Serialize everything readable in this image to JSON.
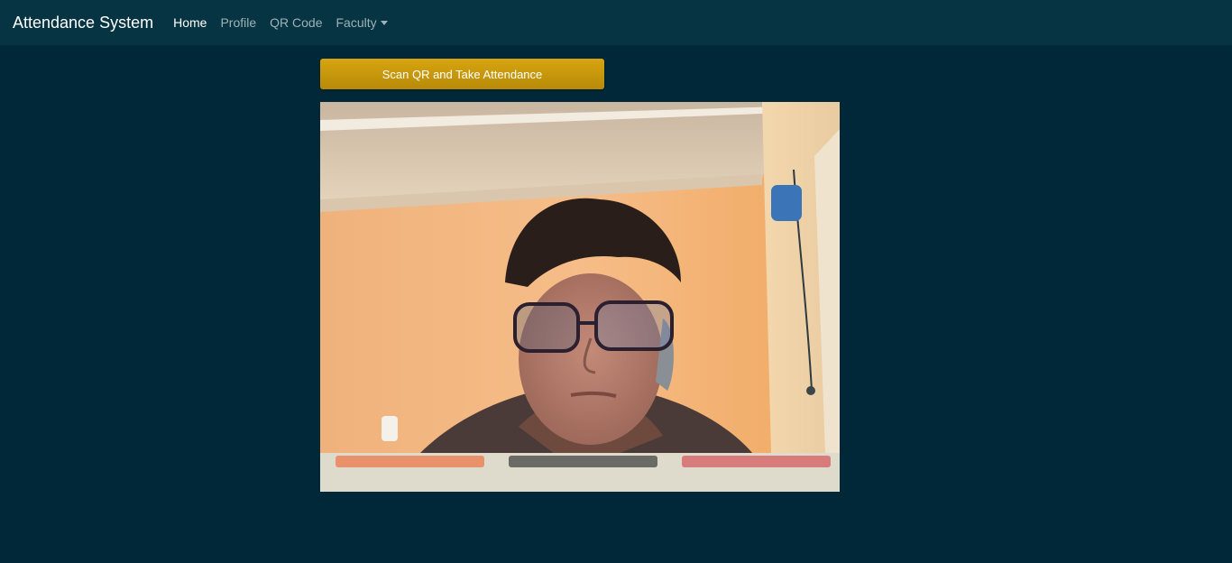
{
  "navbar": {
    "brand": "Attendance System",
    "links": [
      {
        "label": "Home",
        "active": true
      },
      {
        "label": "Profile",
        "active": false
      },
      {
        "label": "QR Code",
        "active": false
      },
      {
        "label": "Faculty",
        "active": false,
        "dropdown": true
      }
    ]
  },
  "main": {
    "scan_button_label": "Scan QR and Take Attendance",
    "camera_feed": {
      "controls": [
        {
          "name": "control-1",
          "color": "#e8916b"
        },
        {
          "name": "control-2",
          "color": "#6a6a66"
        },
        {
          "name": "control-3",
          "color": "#d77b7b"
        }
      ]
    }
  },
  "colors": {
    "page_background": "#002838",
    "navbar_background": "#073442",
    "button_accent": "#c99a0c"
  }
}
